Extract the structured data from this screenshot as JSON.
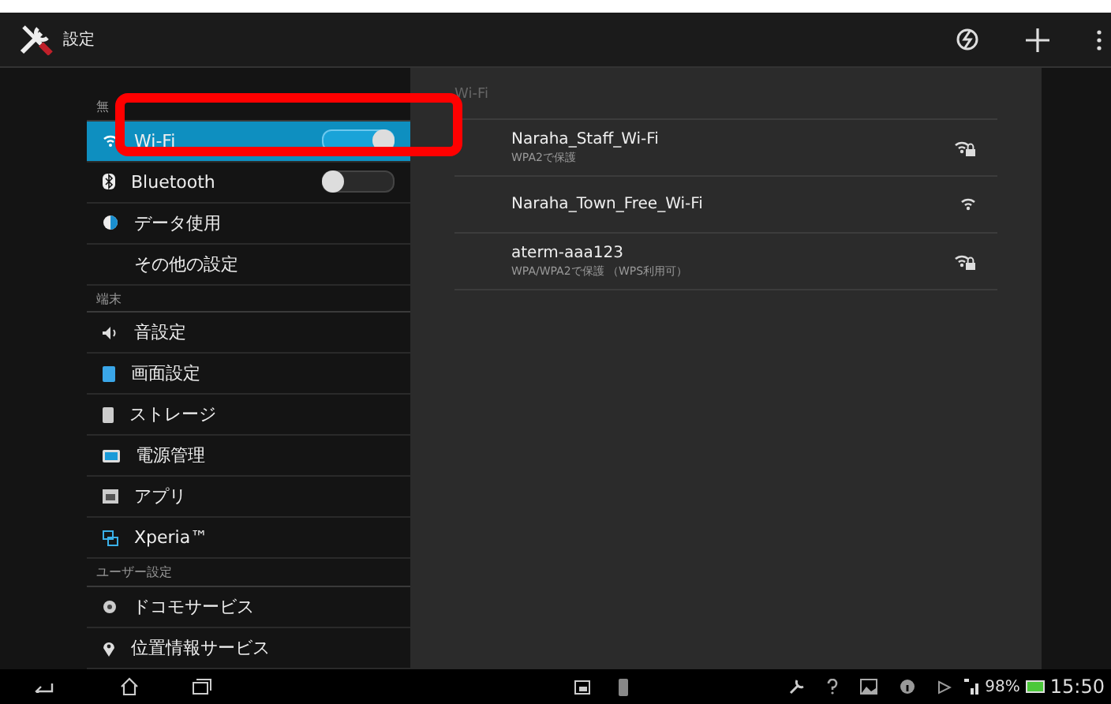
{
  "action_bar": {
    "title": "設定"
  },
  "sidebar": {
    "items": [
      {
        "kind": "header",
        "label": "無"
      },
      {
        "kind": "toggle",
        "label": "Wi-Fi",
        "on": true,
        "selected": true
      },
      {
        "kind": "toggle",
        "label": "Bluetooth",
        "on": false,
        "selected": false
      },
      {
        "kind": "item",
        "label": "データ使用",
        "selected": false
      },
      {
        "kind": "item",
        "label": "その他の設定",
        "selected": false
      },
      {
        "kind": "header",
        "label": "端末"
      },
      {
        "kind": "item",
        "label": "音設定",
        "selected": false
      },
      {
        "kind": "item",
        "label": "画面設定",
        "selected": false
      },
      {
        "kind": "item",
        "label": "ストレージ",
        "selected": false
      },
      {
        "kind": "item",
        "label": "電源管理",
        "selected": false
      },
      {
        "kind": "item",
        "label": "アプリ",
        "selected": false
      },
      {
        "kind": "item",
        "label": "Xperia™",
        "selected": false
      },
      {
        "kind": "header",
        "label": "ユーザー設定"
      },
      {
        "kind": "item",
        "label": "ドコモサービス",
        "selected": false
      },
      {
        "kind": "item",
        "label": "位置情報サービス",
        "selected": false
      }
    ]
  },
  "wifi_panel": {
    "title": "Wi-Fi",
    "networks": [
      {
        "name": "Naraha_Staff_Wi-Fi",
        "security": "WPA2で保護",
        "locked": true
      },
      {
        "name": "Naraha_Town_Free_Wi-Fi",
        "locked": false
      },
      {
        "name": "aterm-aaa123",
        "security": "WPA/WPA2で保護 （WPS利用可）",
        "locked": true
      }
    ]
  },
  "status_bar": {
    "battery": "98%",
    "time": "15:50"
  }
}
